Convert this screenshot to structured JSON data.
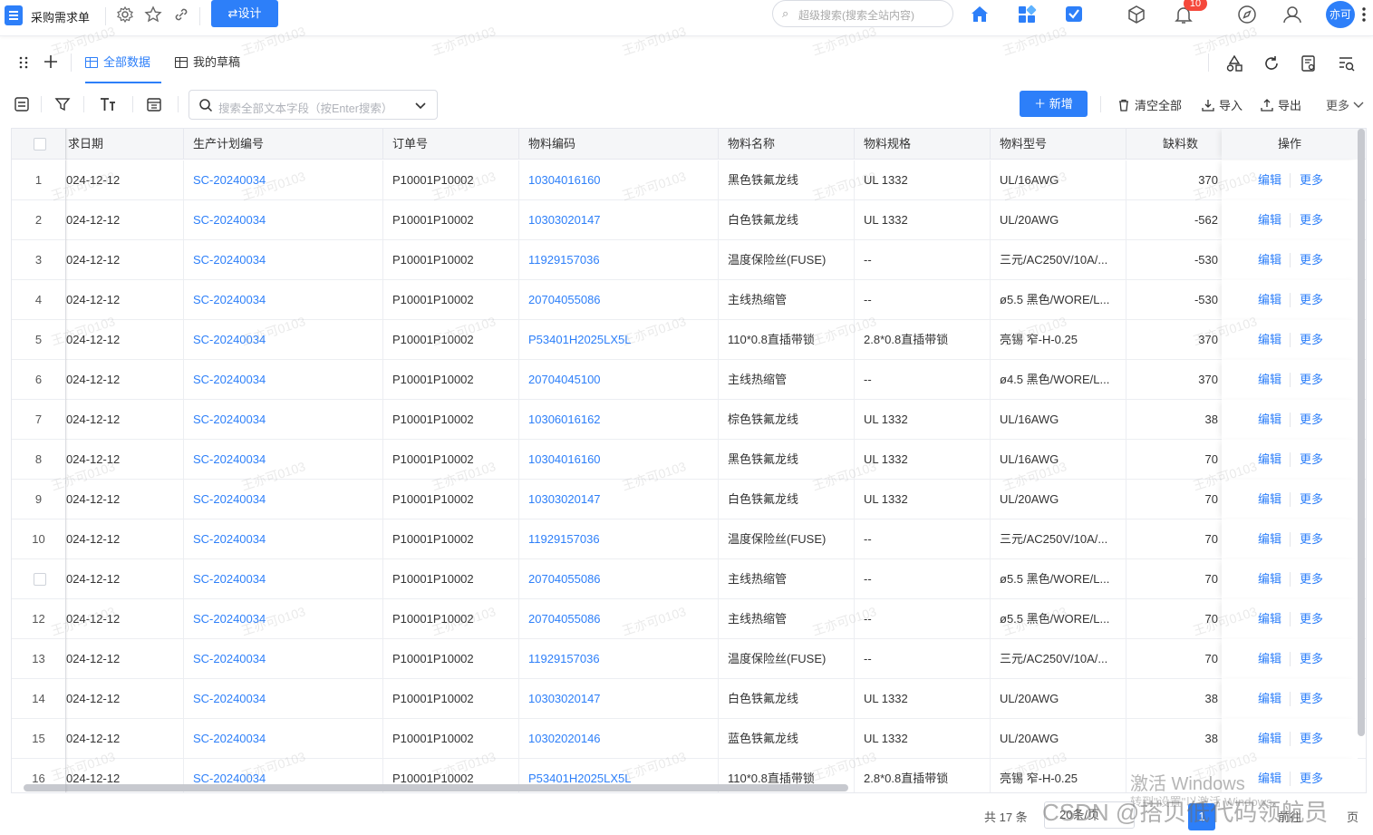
{
  "app": {
    "title": "采购需求单",
    "design_label": "设计",
    "search_placeholder": "超级搜索(搜索全站内容)",
    "notification_count": "10",
    "avatar_text": "亦可"
  },
  "tabs": [
    {
      "label": "全部数据"
    },
    {
      "label": "我的草稿"
    }
  ],
  "toolbar": {
    "search_placeholder": "搜索全部文本字段（按Enter搜索）",
    "add_label": "新增",
    "clear_label": "清空全部",
    "import_label": "导入",
    "export_label": "导出",
    "more_label": "更多"
  },
  "table": {
    "headers": {
      "date": "求日期",
      "plan": "生产计划编号",
      "order": "订单号",
      "code": "物料编码",
      "name": "物料名称",
      "spec": "物料规格",
      "model": "物料型号",
      "shortage": "缺料数",
      "ops": "操作"
    },
    "edit_label": "编辑",
    "more_label": "更多",
    "rows": [
      {
        "idx": "1",
        "date": "024-12-12",
        "plan": "SC-20240034",
        "order": "P10001P10002",
        "code": "10304016160",
        "name": "黑色铁氟龙线",
        "spec": "UL 1332",
        "model": "UL/16AWG",
        "shortage": "370"
      },
      {
        "idx": "2",
        "date": "024-12-12",
        "plan": "SC-20240034",
        "order": "P10001P10002",
        "code": "10303020147",
        "name": "白色铁氟龙线",
        "spec": "UL 1332",
        "model": "UL/20AWG",
        "shortage": "-562"
      },
      {
        "idx": "3",
        "date": "024-12-12",
        "plan": "SC-20240034",
        "order": "P10001P10002",
        "code": "11929157036",
        "name": "温度保险丝(FUSE)",
        "spec": "--",
        "model": "三元/AC250V/10A/...",
        "shortage": "-530"
      },
      {
        "idx": "4",
        "date": "024-12-12",
        "plan": "SC-20240034",
        "order": "P10001P10002",
        "code": "20704055086",
        "name": "主线热缩管",
        "spec": "--",
        "model": "ø5.5 黑色/WORE/L...",
        "shortage": "-530"
      },
      {
        "idx": "5",
        "date": "024-12-12",
        "plan": "SC-20240034",
        "order": "P10001P10002",
        "code": "P53401H2025LX5L",
        "name": "110*0.8直插带锁",
        "spec": "2.8*0.8直插带锁",
        "model": "亮锡 窄-H-0.25",
        "shortage": "370"
      },
      {
        "idx": "6",
        "date": "024-12-12",
        "plan": "SC-20240034",
        "order": "P10001P10002",
        "code": "20704045100",
        "name": "主线热缩管",
        "spec": "--",
        "model": "ø4.5 黑色/WORE/L...",
        "shortage": "370"
      },
      {
        "idx": "7",
        "date": "024-12-12",
        "plan": "SC-20240034",
        "order": "P10001P10002",
        "code": "10306016162",
        "name": "棕色铁氟龙线",
        "spec": "UL 1332",
        "model": "UL/16AWG",
        "shortage": "38"
      },
      {
        "idx": "8",
        "date": "024-12-12",
        "plan": "SC-20240034",
        "order": "P10001P10002",
        "code": "10304016160",
        "name": "黑色铁氟龙线",
        "spec": "UL 1332",
        "model": "UL/16AWG",
        "shortage": "70"
      },
      {
        "idx": "9",
        "date": "024-12-12",
        "plan": "SC-20240034",
        "order": "P10001P10002",
        "code": "10303020147",
        "name": "白色铁氟龙线",
        "spec": "UL 1332",
        "model": "UL/20AWG",
        "shortage": "70"
      },
      {
        "idx": "10",
        "date": "024-12-12",
        "plan": "SC-20240034",
        "order": "P10001P10002",
        "code": "11929157036",
        "name": "温度保险丝(FUSE)",
        "spec": "--",
        "model": "三元/AC250V/10A/...",
        "shortage": "70"
      },
      {
        "idx": "",
        "date": "024-12-12",
        "plan": "SC-20240034",
        "order": "P10001P10002",
        "code": "20704055086",
        "name": "主线热缩管",
        "spec": "--",
        "model": "ø5.5 黑色/WORE/L...",
        "shortage": "70"
      },
      {
        "idx": "12",
        "date": "024-12-12",
        "plan": "SC-20240034",
        "order": "P10001P10002",
        "code": "20704055086",
        "name": "主线热缩管",
        "spec": "--",
        "model": "ø5.5 黑色/WORE/L...",
        "shortage": "70"
      },
      {
        "idx": "13",
        "date": "024-12-12",
        "plan": "SC-20240034",
        "order": "P10001P10002",
        "code": "11929157036",
        "name": "温度保险丝(FUSE)",
        "spec": "--",
        "model": "三元/AC250V/10A/...",
        "shortage": "70"
      },
      {
        "idx": "14",
        "date": "024-12-12",
        "plan": "SC-20240034",
        "order": "P10001P10002",
        "code": "10303020147",
        "name": "白色铁氟龙线",
        "spec": "UL 1332",
        "model": "UL/20AWG",
        "shortage": "38"
      },
      {
        "idx": "15",
        "date": "024-12-12",
        "plan": "SC-20240034",
        "order": "P10001P10002",
        "code": "10302020146",
        "name": "蓝色铁氟龙线",
        "spec": "UL 1332",
        "model": "UL/20AWG",
        "shortage": "38"
      },
      {
        "idx": "16",
        "date": "024-12-12",
        "plan": "SC-20240034",
        "order": "P10001P10002",
        "code": "P53401H2025LX5L",
        "name": "110*0.8直插带锁",
        "spec": "2.8*0.8直插带锁",
        "model": "亮锡 窄-H-0.25",
        "shortage": ""
      }
    ]
  },
  "footer": {
    "total_label": "共 17 条",
    "page_size_label": "20条/页",
    "current_page": "1",
    "prev_label": "前往",
    "next_label": "页"
  },
  "overlays": {
    "watermark": "王亦可0103",
    "windows_activate": "激活 Windows",
    "windows_sub": "转到\"设置\"以激活 Windows。",
    "csdn": "CSDN @搭贝低代码领航员"
  },
  "colors": {
    "accent": "#2d7ff9",
    "badge": "#f5483b"
  }
}
